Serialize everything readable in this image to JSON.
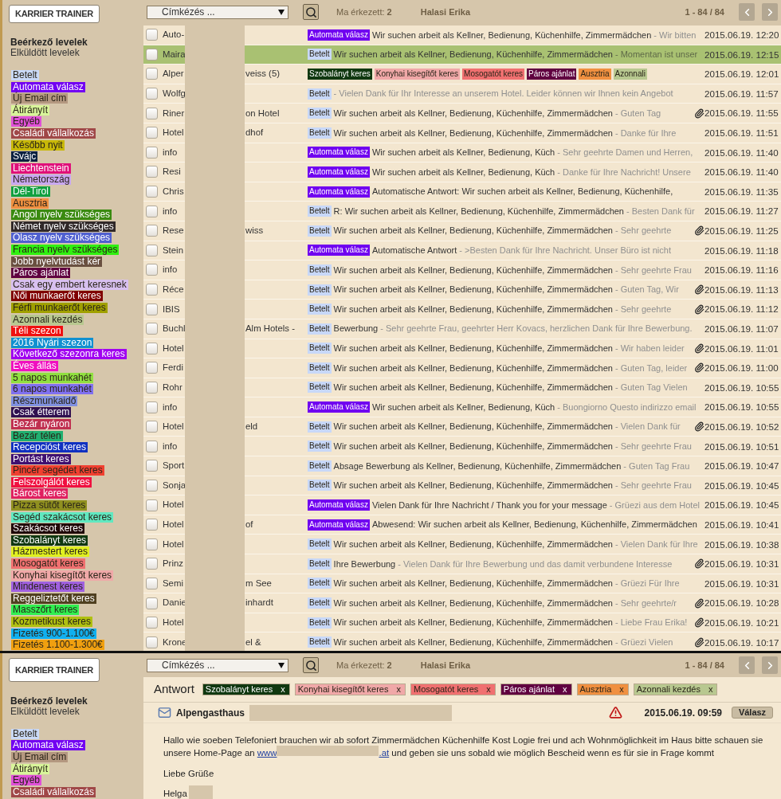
{
  "list_view": {
    "sidebar": {
      "brand": "KARRIER TRAINER",
      "folders": [
        {
          "label": "Beérkező levelek",
          "selected": true
        },
        {
          "label": "Elküldött levelek",
          "selected": false
        }
      ],
      "labels": [
        {
          "label": "Betelt",
          "color": "#c9d9f7"
        },
        {
          "label": "Automata válasz",
          "color": "#7200f2"
        },
        {
          "label": "Új Email cím",
          "color": "#b49880"
        },
        {
          "label": "Átirányít",
          "color": "#d8f59a"
        },
        {
          "label": "Egyéb",
          "color": "#e050d8"
        },
        {
          "label": "Családi vállalkozás",
          "color": "#a04848"
        },
        {
          "label": "Később nyit",
          "color": "#c8b808"
        },
        {
          "label": "Svájc",
          "color": "#0a2040"
        },
        {
          "label": "Liechtenstein",
          "color": "#e0107a"
        },
        {
          "label": "Németország",
          "color": "#c8a8f0"
        },
        {
          "label": "Dél-Tirol",
          "color": "#10a040"
        },
        {
          "label": "Ausztria",
          "color": "#f09040"
        },
        {
          "label": "Angol nyelv szükséges",
          "color": "#3a8a10"
        },
        {
          "label": "Német nyelv szükséges",
          "color": "#302828"
        },
        {
          "label": "Olasz nyelv szükséges",
          "color": "#5060d0"
        },
        {
          "label": "Francia nyelv szükséges",
          "color": "#30f010"
        },
        {
          "label": "Jobb nyelvtudást kér",
          "color": "#6a5040"
        },
        {
          "label": "Páros ajánlat",
          "color": "#600040"
        },
        {
          "label": "Csak egy embert keresnek",
          "color": "#d8c0f0"
        },
        {
          "label": "Női munkaerőt keres",
          "color": "#800000"
        },
        {
          "label": "Férfi munkaerőt keres",
          "color": "#a0a000"
        },
        {
          "label": "Azonnali kezdés",
          "color": "#b8c890"
        },
        {
          "label": "Téli szezon",
          "color": "#f01010"
        },
        {
          "label": "2016 Nyári szezon",
          "color": "#1090d0"
        },
        {
          "label": "Következő szezonra keres",
          "color": "#a000f0"
        },
        {
          "label": "Éves állás",
          "color": "#f010c0"
        },
        {
          "label": "5 napos munkahét",
          "color": "#90e040"
        },
        {
          "label": "6 napos munkahét",
          "color": "#8070f0"
        },
        {
          "label": "Részmunkaidő",
          "color": "#8090e0"
        },
        {
          "label": "Csak étterem",
          "color": "#301050"
        },
        {
          "label": "Bezár nyáron",
          "color": "#c03050"
        },
        {
          "label": "Bezár télen",
          "color": "#20b070"
        },
        {
          "label": "Recepcióst keres",
          "color": "#1030c0"
        },
        {
          "label": "Portást keres",
          "color": "#401070"
        },
        {
          "label": "Pincér segédet keres",
          "color": "#f04030"
        },
        {
          "label": "Felszolgálót keres",
          "color": "#f01040"
        },
        {
          "label": "Bárost keres",
          "color": "#e02060"
        },
        {
          "label": "Pizza sütőt keres",
          "color": "#909020"
        },
        {
          "label": "Segéd szakácsot keres",
          "color": "#60e8c0"
        },
        {
          "label": "Szakácsot keres",
          "color": "#200808"
        },
        {
          "label": "Szobalányt keres",
          "color": "#103810"
        },
        {
          "label": "Házmestert keres",
          "color": "#e0f020"
        },
        {
          "label": "Mosogatót keres",
          "color": "#f07070"
        },
        {
          "label": "Konyhai kisegítőt keres",
          "color": "#f0a8a8"
        },
        {
          "label": "Mindenest keres",
          "color": "#a060e0"
        },
        {
          "label": "Reggeliztetőt keres",
          "color": "#504020"
        },
        {
          "label": "Masszőrt keres",
          "color": "#30f050"
        },
        {
          "label": "Kozmetikust keres",
          "color": "#b0c010"
        },
        {
          "label": "Fizetés 900-1.100€",
          "color": "#10b0f0"
        },
        {
          "label": "Fizetés 1.100-1.300€",
          "color": "#f0a010"
        }
      ]
    },
    "toolbar": {
      "label_select": "Címkézés ...",
      "arrived": "Ma érkezett: **2**",
      "user": "Halasi Erika",
      "range": "1 - 84 / 84"
    },
    "rows": [
      {
        "sender": "Auto-",
        "tags": [
          {
            "label": "Automata válasz",
            "color": "#7000f0"
          }
        ],
        "subject": "Wir suchen arbeit als Kellner, Bedienung, Küchenhilfe, Zimmermädchen",
        "preview": "- Wir bitten",
        "attachment": false,
        "time": "2015.06.19. 12:20",
        "selected": false
      },
      {
        "sender": "Maira",
        "tags": [
          {
            "label": "Betelt",
            "color": "#c8d8f8"
          }
        ],
        "subject": "Wir suchen arbeit als Kellner, Bedienung, Küchenhilfe, Zimmermädchen",
        "preview": "- Momentan ist unser",
        "attachment": false,
        "time": "2015.06.19. 12:15",
        "selected": true
      },
      {
        "sender": "Alper",
        "sender_end": "veiss (5)",
        "tags": [
          {
            "label": "Szobalányt keres",
            "color": "#103810"
          },
          {
            "label": "Konyhai kisegítőt keres",
            "color": "#f0a8a8"
          },
          {
            "label": "Mosogatót keres",
            "color": "#f07070"
          },
          {
            "label": "Páros ajánlat",
            "color": "#600040"
          },
          {
            "label": "Ausztria",
            "color": "#f09040"
          },
          {
            "label": "Azonnali",
            "color": "#b8c890"
          }
        ],
        "attachment": false,
        "time": "2015.06.19. 12:01",
        "selected": false
      },
      {
        "sender": "Wolfg",
        "tags": [
          {
            "label": "Betelt",
            "color": "#c8d8f8"
          }
        ],
        "preview": "- Vielen Dank für Ihr Interesse an unserem Hotel. Leider können wir Ihnen kein Angebot",
        "attachment": false,
        "time": "2015.06.19. 11:57",
        "selected": false
      },
      {
        "sender": "Riner",
        "sender_end": "on Hotel",
        "tags": [
          {
            "label": "Betelt",
            "color": "#c8d8f8"
          }
        ],
        "subject": "Wir suchen arbeit als Kellner, Bedienung, Küchenhilfe, Zimmermädchen",
        "preview": "- Guten Tag",
        "attachment": true,
        "time": "2015.06.19. 11:55",
        "selected": false
      },
      {
        "sender": "Hotel",
        "sender_end": "dhof",
        "tags": [
          {
            "label": "Betelt",
            "color": "#c8d8f8"
          }
        ],
        "subject": "Wir suchen arbeit als Kellner, Bedienung, Küchenhilfe, Zimmermädchen",
        "preview": "- Danke für Ihre",
        "attachment": false,
        "time": "2015.06.19. 11:51",
        "selected": false
      },
      {
        "sender": "info",
        "tags": [
          {
            "label": "Automata válasz",
            "color": "#7000f0"
          }
        ],
        "subject": "Wir suchen arbeit als Kellner, Bedienung, Küch",
        "preview": "- Sehr geehrte Damen und Herren,",
        "attachment": false,
        "time": "2015.06.19. 11:40",
        "selected": false
      },
      {
        "sender": "Resi",
        "tags": [
          {
            "label": "Automata válasz",
            "color": "#7000f0"
          }
        ],
        "subject": "Wir suchen arbeit als Kellner, Bedienung, Küch",
        "preview": "- Danke für Ihre Nachricht! Unsere",
        "attachment": false,
        "time": "2015.06.19. 11:40",
        "selected": false
      },
      {
        "sender": "Chris",
        "tags": [
          {
            "label": "Automata válasz",
            "color": "#7000f0"
          }
        ],
        "subject": "Automatische Antwort: Wir suchen arbeit als Kellner, Bedienung, Küchenhilfe,",
        "attachment": false,
        "time": "2015.06.19. 11:35",
        "selected": false
      },
      {
        "sender": "info",
        "tags": [
          {
            "label": "Betelt",
            "color": "#c8d8f8"
          }
        ],
        "subject": "R: Wir suchen arbeit als Kellner, Bedienung, Küchenhilfe, Zimmermädchen",
        "preview": "- Besten Dank für",
        "attachment": false,
        "time": "2015.06.19. 11:27",
        "selected": false
      },
      {
        "sender": "Rese",
        "sender_end": "wiss",
        "tags": [
          {
            "label": "Betelt",
            "color": "#c8d8f8"
          }
        ],
        "subject": "Wir suchen arbeit als Kellner, Bedienung, Küchenhilfe, Zimmermädchen",
        "preview": "- Sehr geehrte",
        "attachment": true,
        "time": "2015.06.19. 11:25",
        "selected": false
      },
      {
        "sender": "Stein",
        "tags": [
          {
            "label": "Automata válasz",
            "color": "#7000f0"
          }
        ],
        "subject": "Automatische Antwort",
        "preview": "- >Besten Dank für Ihre Nachricht. Unser Büro ist nicht",
        "attachment": false,
        "time": "2015.06.19. 11:18",
        "selected": false
      },
      {
        "sender": "info",
        "tags": [
          {
            "label": "Betelt",
            "color": "#c8d8f8"
          }
        ],
        "subject": "Wir suchen arbeit als Kellner, Bedienung, Küchenhilfe, Zimmermädchen",
        "preview": "- Sehr geehrte Frau",
        "attachment": false,
        "time": "2015.06.19. 11:16",
        "selected": false
      },
      {
        "sender": "Réce",
        "tags": [
          {
            "label": "Betelt",
            "color": "#c8d8f8"
          }
        ],
        "subject": "Wir suchen arbeit als Kellner, Bedienung, Küchenhilfe, Zimmermädchen",
        "preview": "- Guten Tag, Wir",
        "attachment": true,
        "time": "2015.06.19. 11:13",
        "selected": false
      },
      {
        "sender": "IBIS",
        "tags": [
          {
            "label": "Betelt",
            "color": "#c8d8f8"
          }
        ],
        "subject": "Wir suchen arbeit als Kellner, Bedienung, Küchenhilfe, Zimmermädchen",
        "preview": "- Sehr geehrte",
        "attachment": true,
        "time": "2015.06.19. 11:12",
        "selected": false
      },
      {
        "sender": "Buchl",
        "sender_end": "Alm Hotels -",
        "tags": [
          {
            "label": "Betelt",
            "color": "#c8d8f8"
          }
        ],
        "subject": "Bewerbung",
        "preview": "- Sehr geehrte Frau, geehrter Herr Kovacs, herzlichen Dank für Ihre Bewerbung.",
        "attachment": false,
        "time": "2015.06.19. 11:07",
        "selected": false
      },
      {
        "sender": "Hotel",
        "tags": [
          {
            "label": "Betelt",
            "color": "#c8d8f8"
          }
        ],
        "subject": "Wir suchen arbeit als Kellner, Bedienung, Küchenhilfe, Zimmermädchen",
        "preview": "- Wir haben leider",
        "attachment": true,
        "time": "2015.06.19. 11:01",
        "selected": false
      },
      {
        "sender": "Ferdi",
        "tags": [
          {
            "label": "Betelt",
            "color": "#c8d8f8"
          }
        ],
        "subject": "Wir suchen arbeit als Kellner, Bedienung, Küchenhilfe, Zimmermädchen",
        "preview": "- Guten Tag, leider",
        "attachment": true,
        "time": "2015.06.19. 11:00",
        "selected": false
      },
      {
        "sender": "Rohr",
        "tags": [
          {
            "label": "Betelt",
            "color": "#c8d8f8"
          }
        ],
        "subject": "Wir suchen arbeit als Kellner, Bedienung, Küchenhilfe, Zimmermädchen",
        "preview": "- Guten Tag Vielen",
        "attachment": false,
        "time": "2015.06.19. 10:55",
        "selected": false
      },
      {
        "sender": "info",
        "tags": [
          {
            "label": "Automata válasz",
            "color": "#7000f0"
          }
        ],
        "subject": "Wir suchen arbeit als Kellner, Bedienung, Küch",
        "preview": "- Buongiorno Questo indirizzo email",
        "attachment": false,
        "time": "2015.06.19. 10:55",
        "selected": false
      },
      {
        "sender": "Hotel",
        "sender_end": "eld",
        "tags": [
          {
            "label": "Betelt",
            "color": "#c8d8f8"
          }
        ],
        "subject": "Wir suchen arbeit als Kellner, Bedienung, Küchenhilfe, Zimmermädchen",
        "preview": "- Vielen Dank für",
        "attachment": true,
        "time": "2015.06.19. 10:52",
        "selected": false
      },
      {
        "sender": "info",
        "tags": [
          {
            "label": "Betelt",
            "color": "#c8d8f8"
          }
        ],
        "subject": "Wir suchen arbeit als Kellner, Bedienung, Küchenhilfe, Zimmermädchen",
        "preview": "- Sehr geehrte Frau",
        "attachment": false,
        "time": "2015.06.19. 10:51",
        "selected": false
      },
      {
        "sender": "Sport",
        "tags": [
          {
            "label": "Betelt",
            "color": "#c8d8f8"
          }
        ],
        "subject": "Absage Bewerbung als Kellner, Bedienung, Küchenhilfe, Zimmermädchen",
        "preview": "- Guten Tag Frau",
        "attachment": false,
        "time": "2015.06.19. 10:47",
        "selected": false
      },
      {
        "sender": "Sonja",
        "tags": [
          {
            "label": "Betelt",
            "color": "#c8d8f8"
          }
        ],
        "subject": "Wir suchen arbeit als Kellner, Bedienung, Küchenhilfe, Zimmermädchen",
        "preview": "- Sehr geehrte Frau",
        "attachment": false,
        "time": "2015.06.19. 10:45",
        "selected": false
      },
      {
        "sender": "Hotel",
        "tags": [
          {
            "label": "Automata válasz",
            "color": "#7000f0"
          }
        ],
        "subject": "Vielen Dank für Ihre Nachricht / Thank you for your message",
        "preview": "- Grüezi aus dem Hotel",
        "attachment": false,
        "time": "2015.06.19. 10:45",
        "selected": false
      },
      {
        "sender": "Hotel",
        "sender_end": "of",
        "tags": [
          {
            "label": "Automata válasz",
            "color": "#7000f0"
          }
        ],
        "subject": "Abwesend: Wir suchen arbeit als Kellner, Bedienung, Küchenhilfe, Zimmermädchen",
        "attachment": false,
        "time": "2015.06.19. 10:41",
        "selected": false
      },
      {
        "sender": "Hotel",
        "tags": [
          {
            "label": "Betelt",
            "color": "#c8d8f8"
          }
        ],
        "subject": "Wir suchen arbeit als Kellner, Bedienung, Küchenhilfe, Zimmermädchen",
        "preview": "- Vielen Dank für Ihre",
        "attachment": false,
        "time": "2015.06.19. 10:38",
        "selected": false
      },
      {
        "sender": "Prinz",
        "tags": [
          {
            "label": "Betelt",
            "color": "#c8d8f8"
          }
        ],
        "subject": "Ihre Bewerbung",
        "preview": "- Vielen Dank für Ihre Bewerbung und das damit verbundene Interesse",
        "attachment": true,
        "time": "2015.06.19. 10:31",
        "selected": false
      },
      {
        "sender": "Semi",
        "sender_end": "m See",
        "tags": [
          {
            "label": "Betelt",
            "color": "#c8d8f8"
          }
        ],
        "subject": "Wir suchen arbeit als Kellner, Bedienung, Küchenhilfe, Zimmermädchen",
        "preview": "- Grüezi Für Ihre",
        "attachment": false,
        "time": "2015.06.19. 10:31",
        "selected": false
      },
      {
        "sender": "Danie",
        "sender_end": "inhardt",
        "tags": [
          {
            "label": "Betelt",
            "color": "#c8d8f8"
          }
        ],
        "subject": "Wir suchen arbeit als Kellner, Bedienung, Küchenhilfe, Zimmermädchen",
        "preview": "- Sehr geehrte/r",
        "attachment": true,
        "time": "2015.06.19. 10:28",
        "selected": false
      },
      {
        "sender": "Hotel",
        "tags": [
          {
            "label": "Betelt",
            "color": "#c8d8f8"
          }
        ],
        "subject": "Wir suchen arbeit als Kellner, Bedienung, Küchenhilfe, Zimmermädchen",
        "preview": "- Liebe Frau Erika!",
        "attachment": true,
        "time": "2015.06.19. 10:21",
        "selected": false
      },
      {
        "sender": "Krone",
        "sender_end": "el &",
        "tags": [
          {
            "label": "Betelt",
            "color": "#c8d8f8"
          }
        ],
        "subject": "Wir suchen arbeit als Kellner, Bedienung, Küchenhilfe, Zimmermädchen",
        "preview": "- Grüezi Vielen",
        "attachment": true,
        "time": "2015.06.19. 10:17",
        "selected": false
      }
    ]
  },
  "detail_view": {
    "sidebar": {
      "brand": "KARRIER TRAINER",
      "folders": [
        {
          "label": "Beérkező levelek",
          "selected": true
        },
        {
          "label": "Elküldött levelek",
          "selected": false
        }
      ],
      "labels": [
        {
          "label": "Betelt",
          "color": "#c9d9f7"
        },
        {
          "label": "Automata válasz",
          "color": "#7200f2"
        },
        {
          "label": "Új Email cím",
          "color": "#b49880"
        },
        {
          "label": "Átirányít",
          "color": "#d8f59a"
        },
        {
          "label": "Egyéb",
          "color": "#e050d8"
        },
        {
          "label": "Családi vállalkozás",
          "color": "#a04848"
        }
      ]
    },
    "toolbar": {
      "label_select": "Címkézés ...",
      "arrived": "Ma érkezett: **2**",
      "user": "Halasi Erika",
      "range": "1 - 84 / 84"
    },
    "subject": "Antwort",
    "tags": [
      {
        "label": "Szobalányt keres",
        "color": "#103810",
        "remove": "x"
      },
      {
        "label": "Konyhai kisegítőt keres",
        "color": "#f0a8a8",
        "remove": "x"
      },
      {
        "label": "Mosogatót keres",
        "color": "#f07070",
        "remove": "x"
      },
      {
        "label": "Páros ajánlat",
        "color": "#600040",
        "remove": "x"
      },
      {
        "label": "Ausztria",
        "color": "#f09040",
        "remove": "x"
      },
      {
        "label": "Azonnali kezdés",
        "color": "#b8c890",
        "remove": "x"
      }
    ],
    "sender": "Alpengasthaus",
    "time": "2015.06.19. 09:59",
    "reply": "Válasz",
    "body": {
      "before": "Hallo wie soeben Telefoniert brauchen wir ab sofort Zimmermädchen Küchenhilfe Kost Logie frei und ach Wohnmöglichkeit im Haus bitte schauen sie unsere Home-Page an",
      "link_start": "www",
      "link_end": ".at",
      "after": "und geben sie uns sobald wie möglich Bescheid wenn es für sie in Frage kommt"
    },
    "greeting": "Liebe Grüße",
    "signature": "Helga"
  }
}
